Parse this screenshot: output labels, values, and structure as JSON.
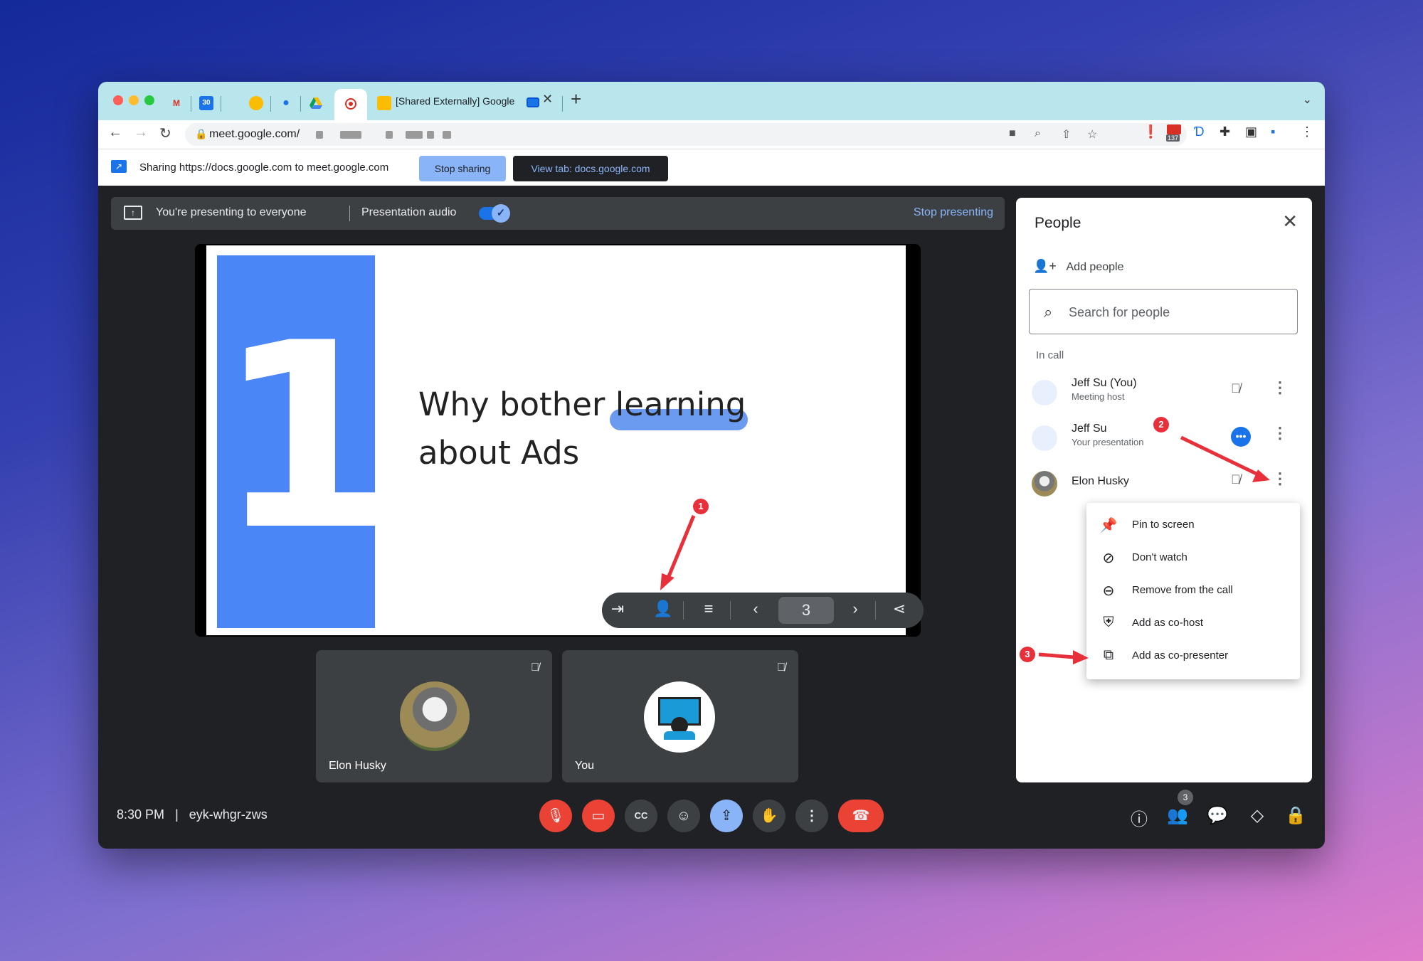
{
  "browser": {
    "tab_title": "[Shared Externally] Google",
    "url": "meet.google.com/",
    "tab_icons": [
      "gmail-icon",
      "calendar-icon",
      "keep-icon",
      "contacts-icon",
      "drive-icon",
      "recording-icon",
      "slides-icon"
    ],
    "calendar_day": "30",
    "extension_badge": "137"
  },
  "sharebar": {
    "text": "Sharing https://docs.google.com to meet.google.com",
    "stop_label": "Stop sharing",
    "view_label": "View tab: docs.google.com"
  },
  "presenting": {
    "text": "You're presenting to everyone",
    "audio_label": "Presentation audio",
    "stop_label": "Stop presenting"
  },
  "slide": {
    "number": "1",
    "title_line1": "Why bother learning",
    "title_line2": "about Ads",
    "page": "3"
  },
  "tiles": [
    {
      "name": "Elon Husky"
    },
    {
      "name": "You"
    }
  ],
  "bottombar": {
    "time": "8:30 PM",
    "separator": "|",
    "meeting_code": "eyk-whgr-zws",
    "people_count": "3"
  },
  "people_panel": {
    "title": "People",
    "add_people": "Add people",
    "search_placeholder": "Search for people",
    "section": "In call",
    "participants": [
      {
        "name": "Jeff Su (You)",
        "subtitle": "Meeting host"
      },
      {
        "name": "Jeff Su",
        "subtitle": "Your presentation"
      },
      {
        "name": "Elon Husky",
        "subtitle": ""
      }
    ]
  },
  "context_menu": {
    "items": [
      {
        "label": "Pin to screen",
        "icon": "pin-icon"
      },
      {
        "label": "Don't watch",
        "icon": "video-off-icon"
      },
      {
        "label": "Remove from the call",
        "icon": "remove-circle-icon"
      },
      {
        "label": "Add as co-host",
        "icon": "shield-add-icon"
      },
      {
        "label": "Add as co-presenter",
        "icon": "co-presenter-icon"
      }
    ]
  },
  "annotations": [
    "1",
    "2",
    "3"
  ],
  "colors": {
    "accent": "#8ab4f8",
    "danger": "#ea4335",
    "slide_blue": "#4a86f5",
    "annotation_red": "#e8303a"
  }
}
